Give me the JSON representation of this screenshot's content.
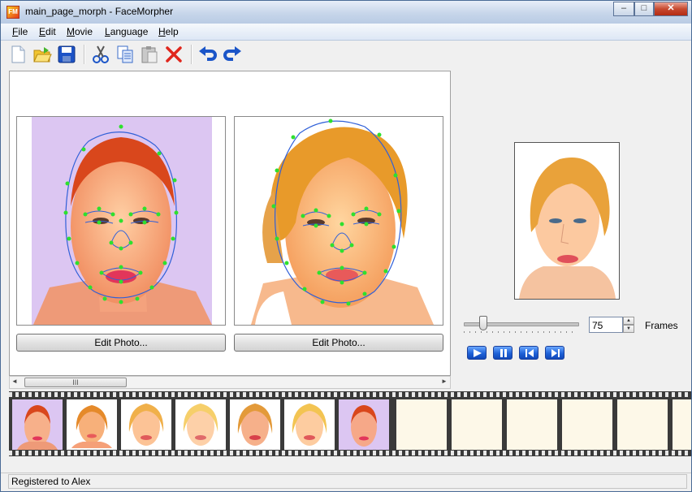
{
  "window": {
    "title": "main_page_morph - FaceMorpher",
    "app_icon_label": "FM",
    "minimize": "–",
    "maximize": "□",
    "close": "✕"
  },
  "menu": [
    {
      "u": "F",
      "rest": "ile"
    },
    {
      "u": "E",
      "rest": "dit"
    },
    {
      "u": "M",
      "rest": "ovie"
    },
    {
      "u": "L",
      "rest": "anguage"
    },
    {
      "u": "H",
      "rest": "elp"
    }
  ],
  "toolbar": {
    "icons": [
      "new-icon",
      "open-icon",
      "save-icon",
      "cut-icon",
      "copy-icon",
      "paste-icon",
      "delete-icon",
      "undo-icon",
      "redo-icon"
    ]
  },
  "editor": {
    "left_edit_label": "Edit Photo...",
    "right_edit_label": "Edit Photo...",
    "scroll_grip": "III",
    "scroll_left": "◄",
    "scroll_right": "►"
  },
  "preview": {
    "frames_value": "75",
    "frames_label": "Frames",
    "spin_up": "▲",
    "spin_down": "▼",
    "controls": [
      "play-icon",
      "pause-icon",
      "rewind-icon",
      "forward-icon"
    ]
  },
  "filmstrip": {
    "filled_frames": 7,
    "empty_frames": 6,
    "selected_index": 1
  },
  "status": {
    "text": "Registered to Alex"
  },
  "colors": {
    "accent_blue": "#1f62d8",
    "delete_red": "#e0261c",
    "landmark_green": "#2ee02e",
    "contour_blue": "#3060d8"
  }
}
